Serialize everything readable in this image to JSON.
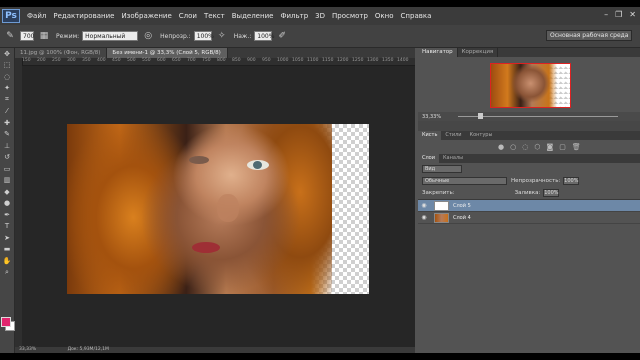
{
  "app": {
    "logo": "Ps",
    "window_controls": [
      "–",
      "❐",
      "✕"
    ]
  },
  "menu": [
    "Файл",
    "Редактирование",
    "Изображение",
    "Слои",
    "Текст",
    "Выделение",
    "Фильтр",
    "3D",
    "Просмотр",
    "Окно",
    "Справка"
  ],
  "options": {
    "brush_size": "700",
    "mode_label": "Режим:",
    "mode_value": "Нормальный",
    "opacity_label": "Непрозр.:",
    "opacity_value": "100%",
    "flow_label": "Наж.:",
    "flow_value": "100%",
    "workspace": "Основная рабочая среда"
  },
  "doc_tabs": [
    {
      "label": "11.jpg @ 100% (Фон, RGB/8)"
    },
    {
      "label": "Без имени-1 @ 33,3% (Слой 5, RGB/8)"
    }
  ],
  "ruler_ticks": [
    "150",
    "200",
    "250",
    "300",
    "350",
    "400",
    "450",
    "500",
    "550",
    "600",
    "650",
    "700",
    "750",
    "800",
    "850",
    "900",
    "950",
    "1000",
    "1050",
    "1100",
    "1150",
    "1200",
    "1250",
    "1300",
    "1350",
    "1400"
  ],
  "status": {
    "zoom": "33,33%",
    "doc": "Док: 5,93М/12,1М"
  },
  "navigator": {
    "tabs": [
      "Навигатор",
      "Коррекция"
    ],
    "zoom": "33,33%"
  },
  "adjust_tabs": [
    "Кисть",
    "Стили",
    "Контуры"
  ],
  "layers": {
    "tabs": [
      "Слои",
      "Каналы"
    ],
    "kind": "Вид",
    "blend": "Обычные",
    "opacity_label": "Непрозрачность:",
    "opacity": "100%",
    "lock_label": "Закрепить:",
    "fill_label": "Заливка:",
    "fill": "100%",
    "items": [
      {
        "name": "Слой 5",
        "active": true
      },
      {
        "name": "Слой 4",
        "active": false
      }
    ]
  },
  "colors": {
    "foreground": "#e0256d",
    "background": "#ffffff",
    "selection": "#6d88a7"
  }
}
